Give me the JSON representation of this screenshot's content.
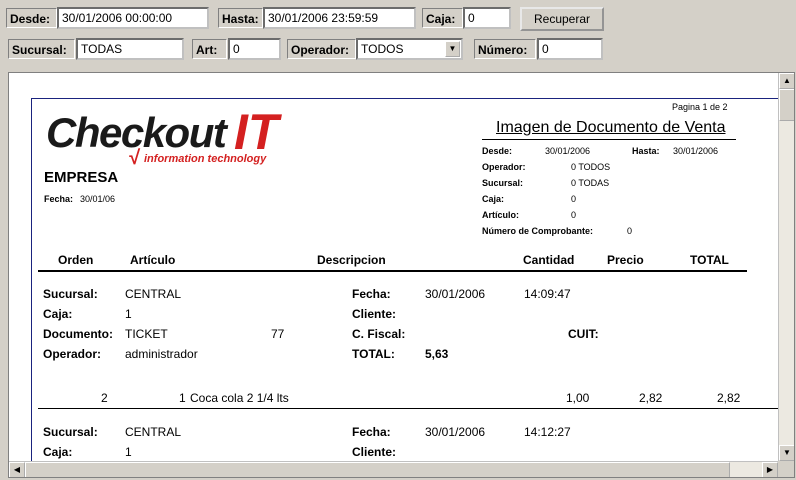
{
  "toolbar": {
    "desde_label": "Desde:",
    "desde_value": "30/01/2006 00:00:00",
    "hasta_label": "Hasta:",
    "hasta_value": "30/01/2006 23:59:59",
    "caja_label": "Caja:",
    "caja_value": "0",
    "recuperar_label": "Recuperar",
    "sucursal_label": "Sucursal:",
    "sucursal_value": "TODAS",
    "art_label": "Art:",
    "art_value": "0",
    "operador_label": "Operador:",
    "operador_value": "TODOS",
    "numero_label": "Número:",
    "numero_value": "0"
  },
  "report": {
    "pagina": "Pagina 1 de 2",
    "logo_main": "Checkout",
    "logo_it": "IT",
    "logo_tagline": "information technology",
    "title": "Imagen de Documento de Venta",
    "empresa": "EMPRESA",
    "fecha_label": "Fecha:",
    "fecha_value": "30/01/06",
    "filters": {
      "desde_label": "Desde:",
      "desde_value": "30/01/2006",
      "hasta_label": "Hasta:",
      "hasta_value": "30/01/2006",
      "operador_label": "Operador:",
      "operador_value": "0 TODOS",
      "sucursal_label": "Sucursal:",
      "sucursal_value": "0 TODAS",
      "caja_label": "Caja:",
      "caja_value": "0",
      "articulo_label": "Artículo:",
      "articulo_value": "0",
      "comprobante_label": "Número de Comprobante:",
      "comprobante_value": "0"
    },
    "columns": [
      "Orden",
      "Artículo",
      "Descripcion",
      "Cantidad",
      "Precio",
      "TOTAL"
    ],
    "doc_labels": {
      "sucursal": "Sucursal:",
      "caja": "Caja:",
      "documento": "Documento:",
      "operador": "Operador:",
      "fecha": "Fecha:",
      "cliente": "Cliente:",
      "cfiscal": "C. Fiscal:",
      "total": "TOTAL:",
      "cuit": "CUIT:"
    },
    "doc1": {
      "sucursal": "CENTRAL",
      "caja": "1",
      "documento": "TICKET",
      "doc_num": "77",
      "operador": "administrador",
      "fecha": "30/01/2006",
      "hora": "14:09:47",
      "total": "5,63"
    },
    "item1": {
      "orden": "2",
      "articulo": "1",
      "descripcion": "Coca cola 2 1/4 lts",
      "cantidad": "1,00",
      "precio": "2,82",
      "total": "2,82"
    },
    "doc2": {
      "sucursal": "CENTRAL",
      "caja": "1",
      "fecha": "30/01/2006",
      "hora": "14:12:27"
    }
  }
}
